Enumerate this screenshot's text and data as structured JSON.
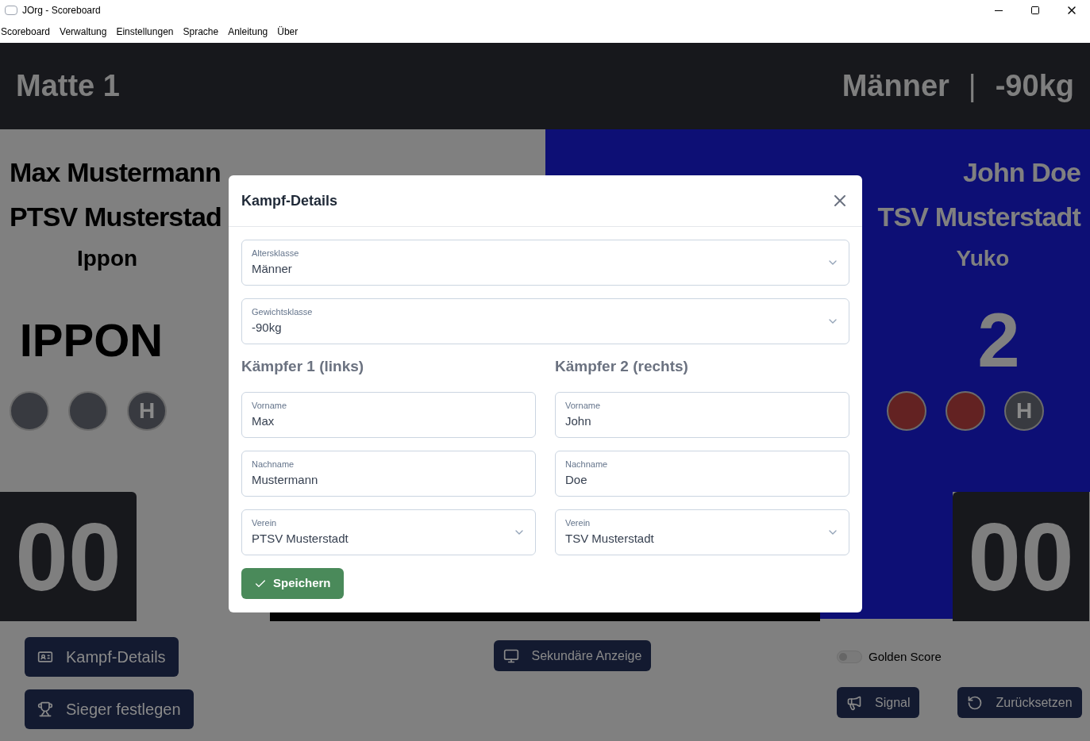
{
  "window": {
    "title": "JOrg - Scoreboard"
  },
  "menu": [
    "Scoreboard",
    "Verwaltung",
    "Einstellungen",
    "Sprache",
    "Anleitung",
    "Über"
  ],
  "header": {
    "mat": "Matte 1",
    "age_class": "Männer",
    "separator": "|",
    "weight_class": "-90kg"
  },
  "fighters": [
    {
      "name": "Max Mustermann",
      "club": "PTSV Musterstad",
      "score_label": "Ippon",
      "result": "IPPON",
      "time": "00",
      "penalties": [
        {
          "kind": "shido",
          "given": false
        },
        {
          "kind": "shido",
          "given": false
        },
        {
          "kind": "hansoku",
          "label": "H",
          "given": false
        }
      ]
    },
    {
      "name": "John Doe",
      "club": "TSV Musterstadt",
      "score_label": "Yuko",
      "result": "2",
      "time": "00",
      "penalties": [
        {
          "kind": "shido",
          "given": true
        },
        {
          "kind": "shido",
          "given": true
        },
        {
          "kind": "hansoku",
          "label": "H",
          "given": false
        }
      ]
    }
  ],
  "controls": {
    "left_buttons": [
      {
        "kind": "details",
        "label": "Kampf-Details"
      },
      {
        "kind": "winner",
        "label": "Sieger festlegen"
      }
    ],
    "display_button": {
      "kind": "display",
      "label": "Sekundäre Anzeige"
    },
    "golden_score": {
      "label": "Golden Score",
      "on": false
    },
    "right_buttons": [
      {
        "kind": "signal",
        "label": "Signal"
      },
      {
        "kind": "reset",
        "label": "Zurücksetzen"
      }
    ]
  },
  "dialog": {
    "title": "Kampf-Details",
    "top_fields": [
      {
        "kind": "select",
        "label": "Altersklasse",
        "value": "Männer"
      },
      {
        "kind": "select",
        "label": "Gewichtsklasse",
        "value": "-90kg"
      }
    ],
    "columns": [
      {
        "heading": "Kämpfer 1 (links)",
        "fields": [
          {
            "kind": "text",
            "label": "Vorname",
            "value": "Max"
          },
          {
            "kind": "text",
            "label": "Nachname",
            "value": "Mustermann"
          },
          {
            "kind": "select",
            "label": "Verein",
            "value": "PTSV Musterstadt"
          }
        ]
      },
      {
        "heading": "Kämpfer 2 (rechts)",
        "fields": [
          {
            "kind": "text",
            "label": "Vorname",
            "value": "John"
          },
          {
            "kind": "text",
            "label": "Nachname",
            "value": "Doe"
          },
          {
            "kind": "select",
            "label": "Verein",
            "value": "TSV Musterstadt"
          }
        ]
      }
    ],
    "save_label": "Speichern"
  }
}
